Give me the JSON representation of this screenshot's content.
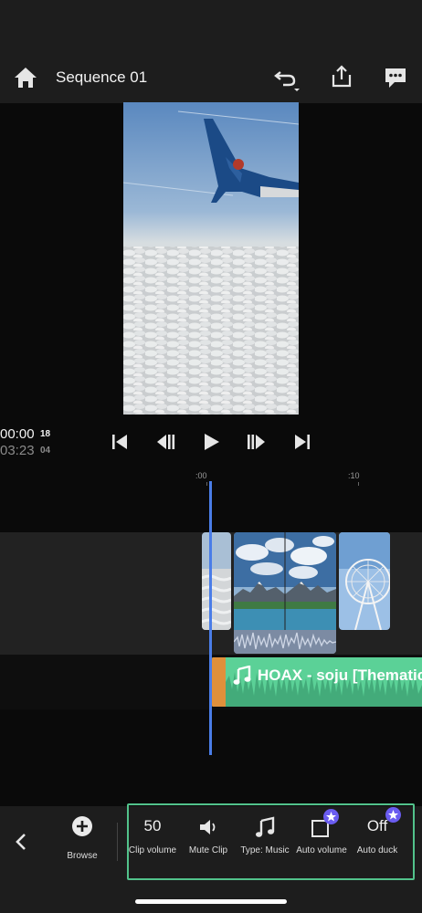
{
  "header": {
    "title": "Sequence 01",
    "icons": [
      "home-icon",
      "undo-icon",
      "share-icon",
      "comment-icon"
    ]
  },
  "transport": {
    "current_time": "00:00",
    "current_frames": "18",
    "total_time": "03:23",
    "total_frames": "04",
    "icons": [
      "skip-to-start-icon",
      "step-back-icon",
      "play-icon",
      "step-forward-icon",
      "skip-to-end-icon"
    ]
  },
  "ruler": {
    "mark0": ":00",
    "mark10": ":10"
  },
  "timeline": {
    "music_clip_label": "HOAX - soju [Thematic"
  },
  "toolbar": {
    "browse_label": "Browse",
    "clip_volume_value": "50",
    "clip_volume_label": "Clip volume",
    "mute_label": "Mute Clip",
    "type_label": "Type: Music",
    "auto_volume_label": "Auto volume",
    "auto_duck_value": "Off",
    "auto_duck_label": "Auto duck"
  },
  "colors": {
    "accent_green": "#52c28b",
    "music_clip": "#5bd197",
    "playhead": "#4a7de8",
    "premium_badge": "#6a5cf0"
  }
}
